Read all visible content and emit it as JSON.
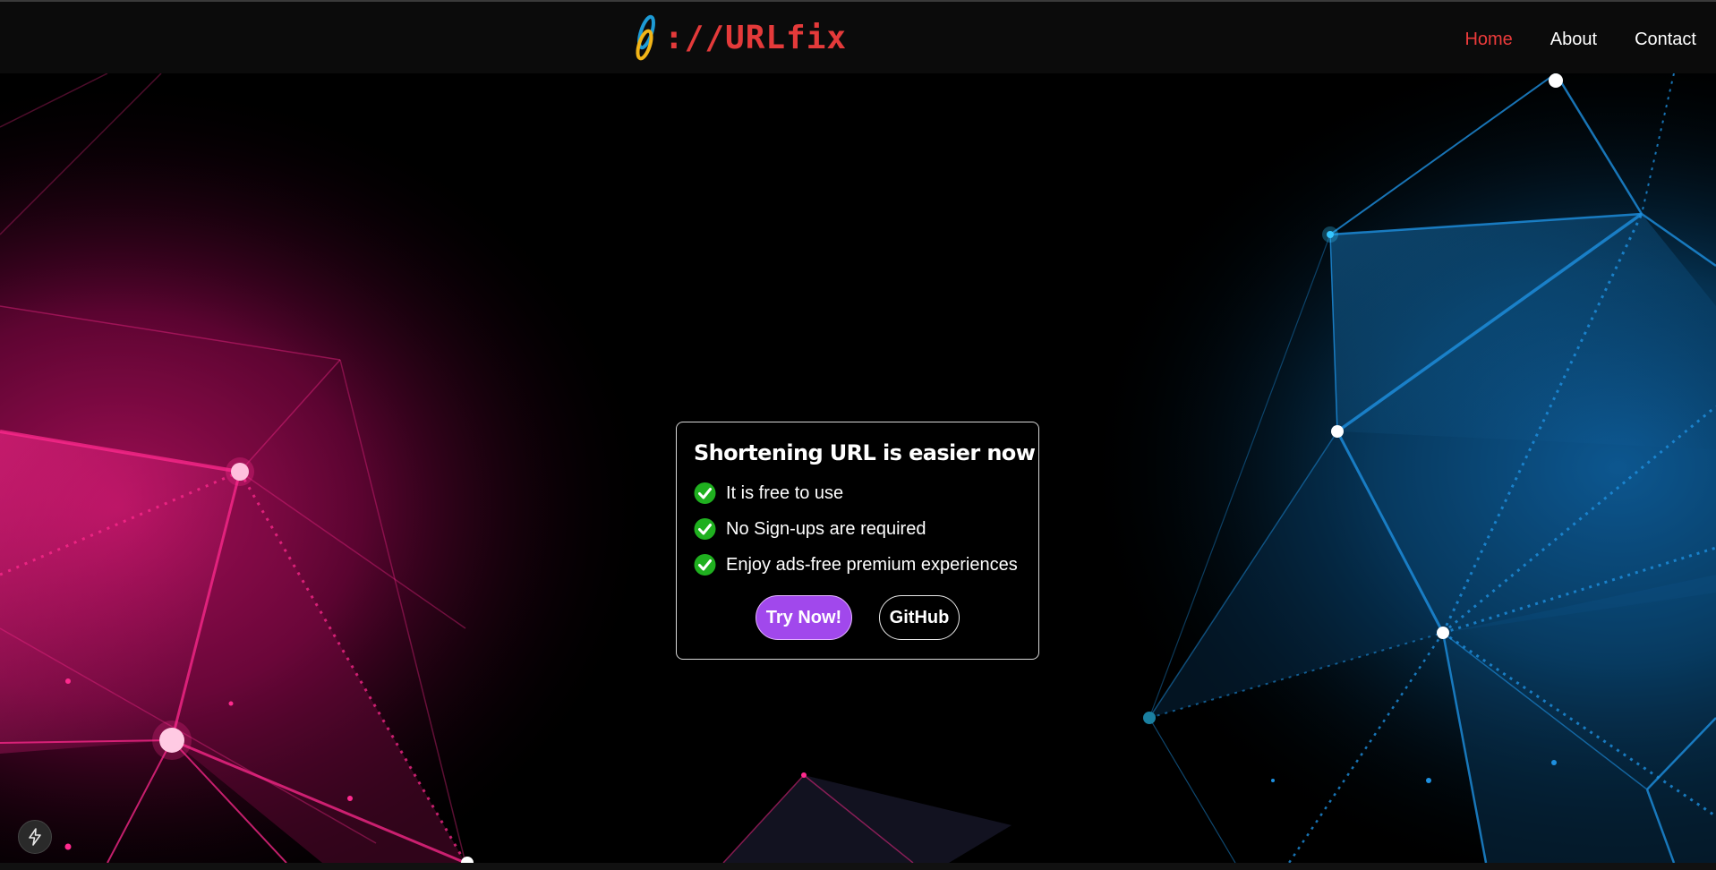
{
  "header": {
    "logo_text": "://URLfix",
    "nav": [
      {
        "label": "Home",
        "active": true
      },
      {
        "label": "About",
        "active": false
      },
      {
        "label": "Contact",
        "active": false
      }
    ]
  },
  "card": {
    "title": "Shortening URL is easier now",
    "features": [
      "It is free to use",
      "No Sign-ups are required",
      "Enjoy ads-free premium experiences"
    ],
    "primary_button": "Try Now!",
    "secondary_button": "GitHub"
  },
  "icons": {
    "check": "check-circle-icon",
    "quick_action": "lightning-icon",
    "logo": "link-icon"
  },
  "colors": {
    "accent_red": "#ec3b3b",
    "check_green": "#1fb01f",
    "button_purple": "#a148ec",
    "network_pink": "#ff1a8c",
    "network_blue": "#1e90e0"
  }
}
